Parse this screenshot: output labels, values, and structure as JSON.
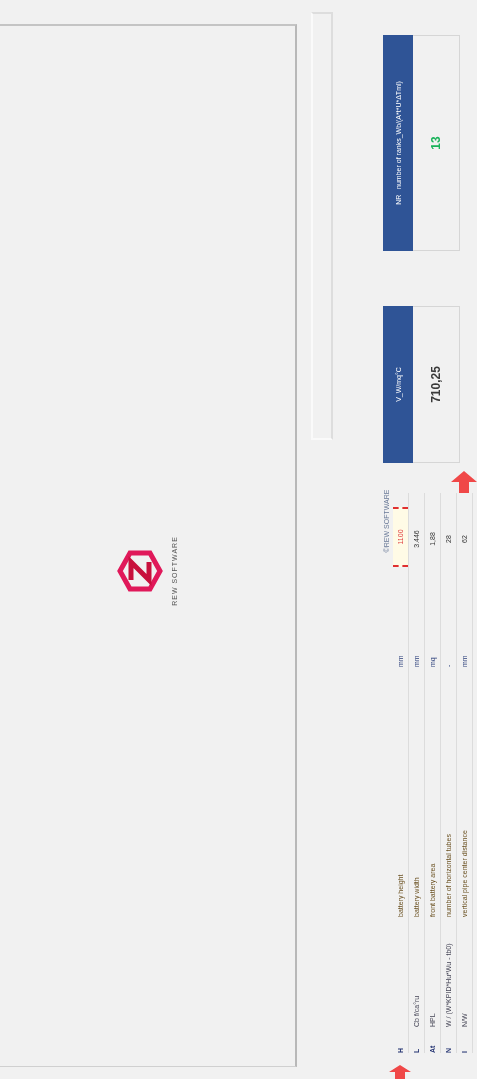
{
  "brand": {
    "name": "REW SOFTWARE"
  },
  "table": {
    "caption": "©REW SOFTWARE",
    "rows": [
      {
        "symbol": "H",
        "formula": "",
        "description": "battery height",
        "unit": "mm",
        "value": "1100",
        "highlighted": true
      },
      {
        "symbol": "L",
        "formula": "Cb f/ca°ru",
        "description": "battery width",
        "unit": "mm",
        "value": "3.446",
        "highlighted": false
      },
      {
        "symbol": "At",
        "formula": "HPL",
        "description": "front battery area",
        "unit": "mq",
        "value": "1,88",
        "highlighted": false
      },
      {
        "symbol": "N",
        "formula": "W / (W*KPID*Hu*Wu - tb0)",
        "description": "number of horizontal tubes",
        "unit": "-",
        "value": "28",
        "highlighted": false
      },
      {
        "symbol": "I",
        "formula": "N/W",
        "description": "vertical pipe center distance",
        "unit": "mm",
        "value": "62",
        "highlighted": false
      }
    ]
  },
  "results": [
    {
      "label": "V_W/mq°C",
      "value": "710,25",
      "color": "#3a3a3a"
    },
    {
      "label": "NR   number of ranks_Wb/(A*t*U*ΔTml)",
      "value": "13",
      "color": "#19b35a"
    }
  ]
}
